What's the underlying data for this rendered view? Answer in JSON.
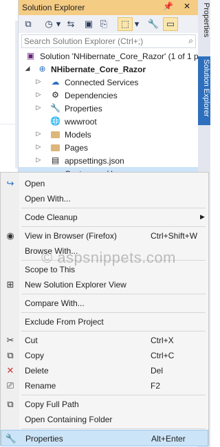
{
  "panel": {
    "title": "Solution Explorer",
    "pin_glyph": "📌",
    "close_glyph": "✕",
    "search_placeholder": "Search Solution Explorer (Ctrl+;)",
    "search_icon": "⌕"
  },
  "toolbar": {
    "icons": [
      "vs-switch-views-icon",
      "history-icon",
      "back-icon",
      "sync-icon",
      "collapse-icon",
      "copy-icon",
      "show-files-icon",
      "dropdown-icon",
      "wrench-icon",
      "properties-icon"
    ],
    "glyphs": [
      "⧉",
      "◷",
      "▾",
      "⇆",
      "▣",
      "⎘",
      "⬚",
      "▾",
      "🔧",
      "▭"
    ]
  },
  "tree": {
    "solution": "Solution 'NHibernate_Core_Razor' (1 of 1 pr",
    "project": "NHibernate_Core_Razor",
    "items": [
      {
        "label": "Connected Services",
        "icon": "connected-services-icon"
      },
      {
        "label": "Dependencies",
        "icon": "dependencies-icon"
      },
      {
        "label": "Properties",
        "icon": "properties-wrench-icon"
      },
      {
        "label": "wwwroot",
        "icon": "globe-icon"
      },
      {
        "label": "Models",
        "icon": "folder-icon"
      },
      {
        "label": "Pages",
        "icon": "folder-icon"
      },
      {
        "label": "appsettings.json",
        "icon": "json-file-icon"
      },
      {
        "label": "Customers.Home.cs",
        "icon": "file-icon"
      }
    ]
  },
  "side_tabs": [
    "Properties",
    "Solution Explorer"
  ],
  "menu": {
    "items": [
      {
        "label": "Open",
        "shortcut": "",
        "icon": "open-arrow-icon",
        "glyph": "↪"
      },
      {
        "label": "Open With...",
        "shortcut": "",
        "icon": "",
        "glyph": ""
      },
      {
        "label": "Code Cleanup",
        "shortcut": "",
        "icon": "",
        "glyph": "",
        "submenu": "▶"
      },
      {
        "label": "View in Browser (Firefox)",
        "shortcut": "Ctrl+Shift+W",
        "icon": "browser-icon",
        "glyph": "◉"
      },
      {
        "label": "Browse With...",
        "shortcut": "",
        "icon": "",
        "glyph": ""
      },
      {
        "label": "Scope to This",
        "shortcut": "",
        "icon": "",
        "glyph": ""
      },
      {
        "label": "New Solution Explorer View",
        "shortcut": "",
        "icon": "new-view-icon",
        "glyph": "⊞"
      },
      {
        "label": "Compare With...",
        "shortcut": "",
        "icon": "",
        "glyph": ""
      },
      {
        "label": "Exclude From Project",
        "shortcut": "",
        "icon": "",
        "glyph": ""
      },
      {
        "label": "Cut",
        "shortcut": "Ctrl+X",
        "icon": "scissors-icon",
        "glyph": "✂"
      },
      {
        "label": "Copy",
        "shortcut": "Ctrl+C",
        "icon": "copy-icon",
        "glyph": "⧉"
      },
      {
        "label": "Delete",
        "shortcut": "Del",
        "icon": "delete-x-icon",
        "glyph": "✕"
      },
      {
        "label": "Rename",
        "shortcut": "F2",
        "icon": "rename-icon",
        "glyph": "⎚"
      },
      {
        "label": "Copy Full Path",
        "shortcut": "",
        "icon": "copy-path-icon",
        "glyph": "⧉"
      },
      {
        "label": "Open Containing Folder",
        "shortcut": "",
        "icon": "",
        "glyph": ""
      },
      {
        "label": "Properties",
        "shortcut": "Alt+Enter",
        "icon": "wrench-icon",
        "glyph": "🔧"
      }
    ]
  },
  "watermark": "© aspsnippets.com",
  "colors": {
    "title_bar": "#f5cc84",
    "menu_hover": "#cce4f7",
    "accent": "#2e6fbd"
  }
}
